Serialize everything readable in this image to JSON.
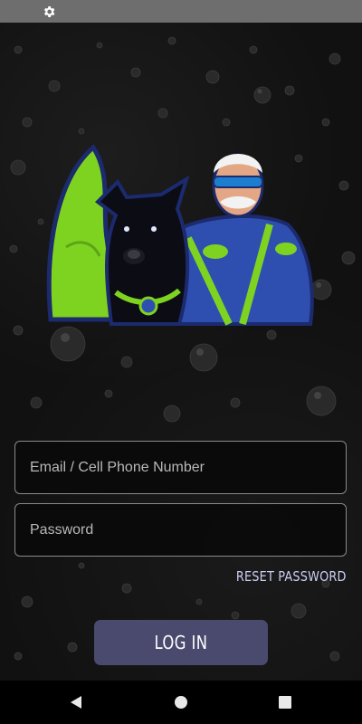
{
  "status_bar": {
    "icon": "gear-icon"
  },
  "login": {
    "email_placeholder": "Email / Cell Phone Number",
    "password_placeholder": "Password",
    "reset_label": "RESET PASSWORD",
    "login_label": "LOG IN"
  },
  "nav_bar": {
    "back_icon": "back-triangle-icon",
    "home_icon": "home-circle-icon",
    "recents_icon": "recents-square-icon"
  },
  "colors": {
    "accent_text": "#c9cff3",
    "button_bg": "#4a4a6e",
    "logo_green": "#7ed321",
    "logo_blue": "#2f4fb0"
  }
}
